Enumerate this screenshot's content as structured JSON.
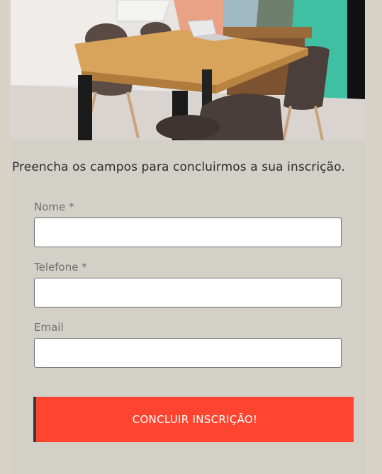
{
  "intro_text": "Preencha os campos para concluirmos a sua inscrição.",
  "form": {
    "fields": [
      {
        "label": "Nome *",
        "value": "",
        "placeholder": ""
      },
      {
        "label": "Telefone *",
        "value": "",
        "placeholder": ""
      },
      {
        "label": "Email",
        "value": "",
        "placeholder": ""
      }
    ],
    "submit_label": "CONCLUIR INSCRIÇÃO!"
  },
  "colors": {
    "background": "#d9d3c7",
    "card": "#d3d0c8",
    "accent": "#ff4530",
    "button_border": "#3a3a3a"
  }
}
